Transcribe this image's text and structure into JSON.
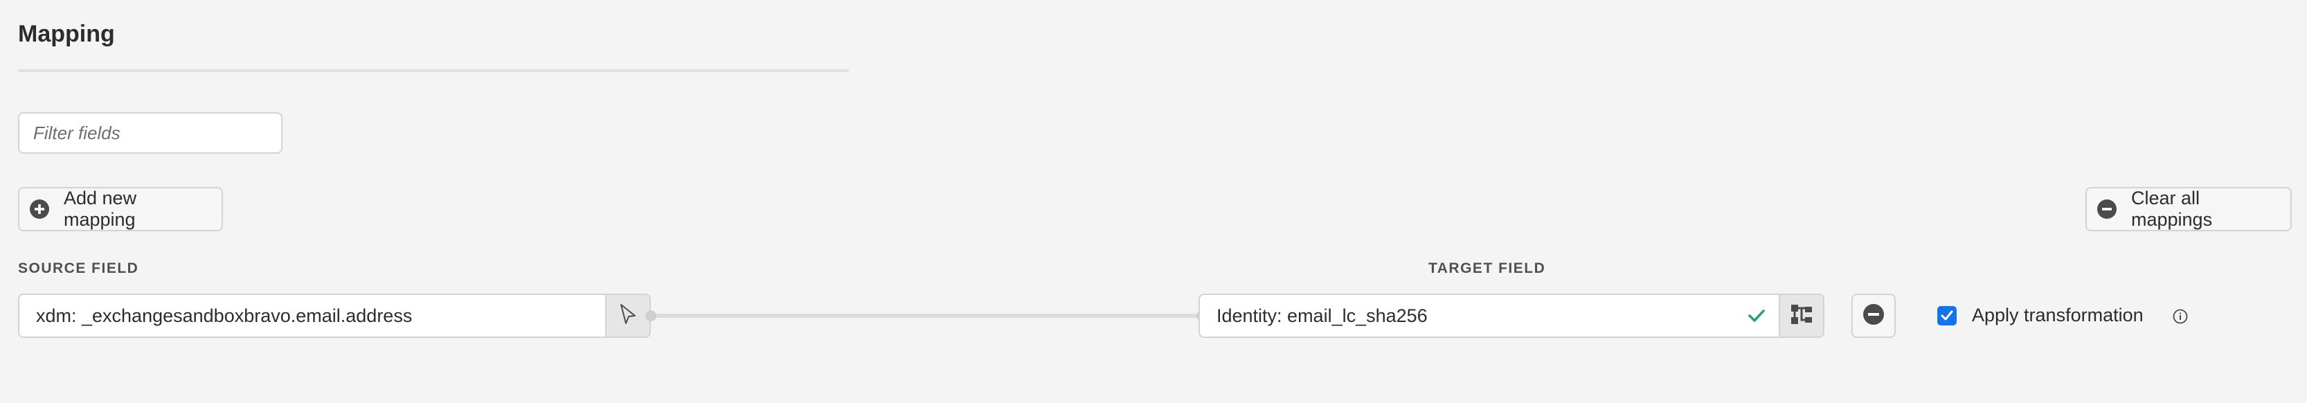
{
  "header": {
    "title": "Mapping"
  },
  "filter": {
    "placeholder": "Filter fields"
  },
  "actions": {
    "add_label": "Add new mapping",
    "clear_label": "Clear all mappings"
  },
  "columns": {
    "source_label": "SOURCE FIELD",
    "target_label": "TARGET FIELD"
  },
  "mapping": {
    "source_value": "xdm: _exchangesandboxbravo.email.address",
    "target_value": "Identity: email_lc_sha256",
    "target_valid": true,
    "apply_transformation_label": "Apply transformation",
    "apply_transformation_checked": true
  },
  "icons": {
    "add": "plus-circle-icon",
    "clear": "minus-circle-icon",
    "source_picker": "cursor-select-icon",
    "target_valid": "checkmark-icon",
    "target_picker": "schema-tree-icon",
    "remove": "minus-circle-icon",
    "info": "info-icon"
  },
  "colors": {
    "background": "#f4f4f4",
    "accent": "#1473e6",
    "success": "#2d9d78",
    "icon": "#4b4b4b"
  }
}
